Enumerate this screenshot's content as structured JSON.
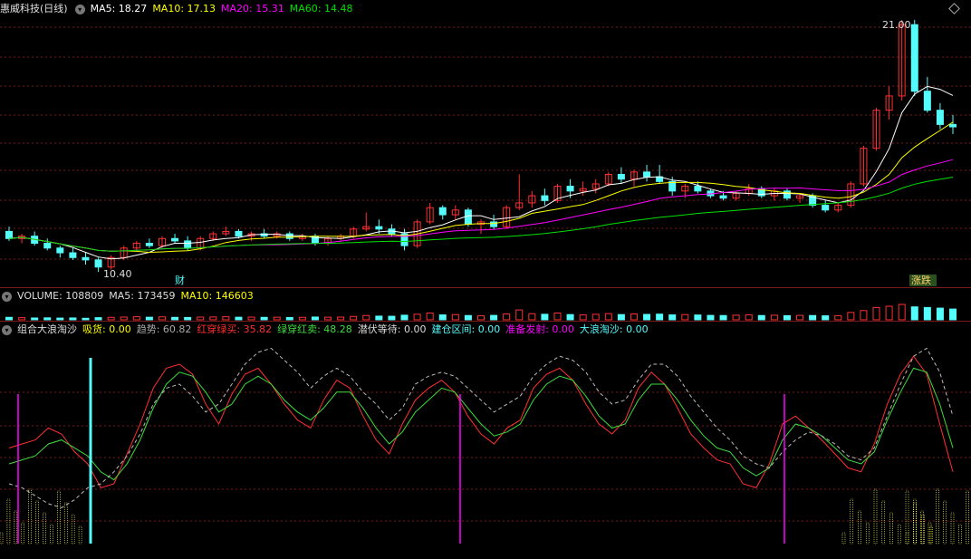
{
  "main_header": {
    "title": "惠威科技(日线)",
    "ma5": "MA5: 18.27",
    "ma10": "MA10: 17.13",
    "ma20": "MA20: 15.31",
    "ma60": "MA60: 14.48"
  },
  "price_labels": {
    "high": "21.00",
    "low": "10.40",
    "cai": "财",
    "zhang_die": "涨跌"
  },
  "volume_header": {
    "volume": "VOLUME: 108809",
    "ma5": "MA5: 173459",
    "ma10": "MA10: 146603"
  },
  "indicator_header": {
    "name": "组合大浪淘沙",
    "xihuo": "吸货: 0.00",
    "qushi": "趋势: 60.82",
    "hongchuan": "红穿绿买: 35.82",
    "lvchuan": "绿穿红卖: 48.28",
    "qianfu": "潜伏等待: 0.00",
    "jiancang": "建仓区间: 0.00",
    "zhunbei": "准备发射: 0.00",
    "dalang": "大浪淘沙: 0.00"
  },
  "colors": {
    "background": "#000000",
    "up": "#ff3030",
    "down": "#54fcfc",
    "ma5": "#ffffff",
    "ma10": "#ffff00",
    "ma20": "#ff00ff",
    "ma60": "#00e000",
    "grid": "#7a1a1a"
  },
  "chart_data": [
    {
      "type": "candlestick",
      "title": "惠威科技(日线)",
      "y_range": [
        10.4,
        21.0
      ],
      "ohlc": [
        [
          12.1,
          12.3,
          11.7,
          11.8
        ],
        [
          11.8,
          12.0,
          11.6,
          11.9
        ],
        [
          11.9,
          12.1,
          11.5,
          11.6
        ],
        [
          11.6,
          11.8,
          11.3,
          11.4
        ],
        [
          11.4,
          11.5,
          11.0,
          11.2
        ],
        [
          11.2,
          11.4,
          10.9,
          11.0
        ],
        [
          11.0,
          11.2,
          10.7,
          10.9
        ],
        [
          10.9,
          11.0,
          10.4,
          10.6
        ],
        [
          10.6,
          11.1,
          10.5,
          11.0
        ],
        [
          11.0,
          11.5,
          10.9,
          11.4
        ],
        [
          11.4,
          11.7,
          11.3,
          11.6
        ],
        [
          11.6,
          11.8,
          11.4,
          11.5
        ],
        [
          11.5,
          11.9,
          11.4,
          11.8
        ],
        [
          11.8,
          12.0,
          11.6,
          11.7
        ],
        [
          11.7,
          11.9,
          11.3,
          11.4
        ],
        [
          11.4,
          11.9,
          11.3,
          11.8
        ],
        [
          11.8,
          12.1,
          11.7,
          12.0
        ],
        [
          12.0,
          12.3,
          11.9,
          12.1
        ],
        [
          12.1,
          12.2,
          11.8,
          11.9
        ],
        [
          11.9,
          12.1,
          11.7,
          12.0
        ],
        [
          12.0,
          12.2,
          11.8,
          11.9
        ],
        [
          11.9,
          12.1,
          11.8,
          12.0
        ],
        [
          12.0,
          12.1,
          11.7,
          11.8
        ],
        [
          11.8,
          12.0,
          11.7,
          11.9
        ],
        [
          11.9,
          12.0,
          11.5,
          11.6
        ],
        [
          11.6,
          11.9,
          11.5,
          11.8
        ],
        [
          11.8,
          12.0,
          11.7,
          11.9
        ],
        [
          11.9,
          12.3,
          11.8,
          12.2
        ],
        [
          12.2,
          12.9,
          12.1,
          12.3
        ],
        [
          12.3,
          12.6,
          12.0,
          12.2
        ],
        [
          12.2,
          12.4,
          11.9,
          12.0
        ],
        [
          12.0,
          12.2,
          11.3,
          11.5
        ],
        [
          11.5,
          12.6,
          11.4,
          12.5
        ],
        [
          12.5,
          13.3,
          12.4,
          13.1
        ],
        [
          13.1,
          13.2,
          12.6,
          12.8
        ],
        [
          12.8,
          13.2,
          12.6,
          13.0
        ],
        [
          13.0,
          13.1,
          12.3,
          12.4
        ],
        [
          12.4,
          12.6,
          12.0,
          12.5
        ],
        [
          12.5,
          12.8,
          12.2,
          12.3
        ],
        [
          12.3,
          13.2,
          12.2,
          13.1
        ],
        [
          13.1,
          14.5,
          13.0,
          13.3
        ],
        [
          13.3,
          13.8,
          13.1,
          13.6
        ],
        [
          13.6,
          13.9,
          13.2,
          13.4
        ],
        [
          13.4,
          14.1,
          13.3,
          14.0
        ],
        [
          14.0,
          14.3,
          13.5,
          13.8
        ],
        [
          13.8,
          14.2,
          13.6,
          13.9
        ],
        [
          13.9,
          14.3,
          13.7,
          14.1
        ],
        [
          14.1,
          14.6,
          14.0,
          14.5
        ],
        [
          14.5,
          14.8,
          14.1,
          14.3
        ],
        [
          14.3,
          14.7,
          14.0,
          14.6
        ],
        [
          14.6,
          14.9,
          14.2,
          14.4
        ],
        [
          14.4,
          14.9,
          14.1,
          14.2
        ],
        [
          14.2,
          14.4,
          13.6,
          13.8
        ],
        [
          13.8,
          14.1,
          13.5,
          14.0
        ],
        [
          14.0,
          14.2,
          13.7,
          13.8
        ],
        [
          13.8,
          13.9,
          13.5,
          13.6
        ],
        [
          13.6,
          13.8,
          13.4,
          13.5
        ],
        [
          13.5,
          13.8,
          13.4,
          13.7
        ],
        [
          13.7,
          14.1,
          13.6,
          13.9
        ],
        [
          13.9,
          14.0,
          13.5,
          13.6
        ],
        [
          13.6,
          13.9,
          13.4,
          13.8
        ],
        [
          13.8,
          13.9,
          13.4,
          13.5
        ],
        [
          13.5,
          13.7,
          13.3,
          13.6
        ],
        [
          13.6,
          13.7,
          13.1,
          13.2
        ],
        [
          13.2,
          13.4,
          12.9,
          13.0
        ],
        [
          13.0,
          13.3,
          12.9,
          13.2
        ],
        [
          13.2,
          14.2,
          13.1,
          14.1
        ],
        [
          14.1,
          15.7,
          14.0,
          15.6
        ],
        [
          15.6,
          17.3,
          15.5,
          17.2
        ],
        [
          17.2,
          18.2,
          16.8,
          17.8
        ],
        [
          17.8,
          21.0,
          17.6,
          20.8
        ],
        [
          20.8,
          21.0,
          17.8,
          18.0
        ],
        [
          18.0,
          18.6,
          17.1,
          17.2
        ],
        [
          17.2,
          17.5,
          16.4,
          16.6
        ],
        [
          16.6,
          17.0,
          16.2,
          16.5
        ]
      ]
    },
    {
      "type": "bar",
      "title": "VOLUME: 108809",
      "values": [
        40,
        35,
        30,
        32,
        28,
        30,
        25,
        35,
        40,
        45,
        50,
        42,
        48,
        40,
        38,
        44,
        46,
        50,
        42,
        44,
        40,
        42,
        38,
        40,
        45,
        42,
        44,
        55,
        70,
        60,
        58,
        75,
        90,
        110,
        80,
        85,
        70,
        65,
        72,
        95,
        160,
        100,
        90,
        110,
        85,
        80,
        90,
        100,
        85,
        95,
        88,
        92,
        80,
        85,
        78,
        72,
        70,
        75,
        82,
        70,
        75,
        68,
        72,
        70,
        65,
        68,
        120,
        150,
        200,
        220,
        250,
        210,
        200,
        190,
        175
      ]
    },
    {
      "type": "line",
      "title": "组合大浪淘沙",
      "y_range": [
        0,
        100
      ],
      "series": [
        {
          "name": "红穿绿买",
          "values": [
            48,
            50,
            52,
            58,
            55,
            46,
            40,
            28,
            30,
            45,
            60,
            78,
            88,
            90,
            85,
            70,
            60,
            75,
            85,
            88,
            80,
            70,
            62,
            58,
            72,
            82,
            78,
            64,
            52,
            45,
            60,
            72,
            78,
            82,
            76,
            64,
            55,
            50,
            58,
            62,
            78,
            85,
            88,
            82,
            70,
            60,
            55,
            62,
            78,
            86,
            80,
            68,
            55,
            48,
            42,
            40,
            30,
            28,
            40,
            60,
            64,
            58,
            52,
            45,
            38,
            36,
            50,
            70,
            85,
            94,
            85,
            60,
            36
          ]
        },
        {
          "name": "绿穿红卖",
          "values": [
            40,
            42,
            44,
            50,
            52,
            48,
            44,
            36,
            32,
            40,
            52,
            68,
            80,
            86,
            84,
            76,
            66,
            70,
            80,
            84,
            80,
            72,
            66,
            62,
            68,
            76,
            76,
            68,
            58,
            50,
            56,
            66,
            72,
            78,
            76,
            68,
            60,
            54,
            56,
            60,
            72,
            80,
            84,
            82,
            74,
            64,
            58,
            60,
            72,
            80,
            80,
            72,
            62,
            54,
            48,
            46,
            38,
            34,
            38,
            52,
            60,
            58,
            54,
            48,
            42,
            40,
            46,
            62,
            76,
            88,
            86,
            70,
            48
          ]
        },
        {
          "name": "趋势",
          "values": [
            30,
            28,
            24,
            20,
            18,
            22,
            28,
            30,
            36,
            44,
            55,
            70,
            78,
            80,
            74,
            66,
            70,
            80,
            90,
            96,
            98,
            92,
            86,
            78,
            84,
            88,
            84,
            76,
            70,
            62,
            68,
            80,
            84,
            86,
            84,
            78,
            72,
            66,
            70,
            74,
            84,
            90,
            94,
            92,
            86,
            76,
            70,
            72,
            82,
            90,
            90,
            84,
            74,
            66,
            58,
            52,
            44,
            40,
            38,
            46,
            52,
            56,
            54,
            50,
            44,
            42,
            48,
            64,
            80,
            94,
            98,
            86,
            64
          ]
        }
      ]
    }
  ]
}
